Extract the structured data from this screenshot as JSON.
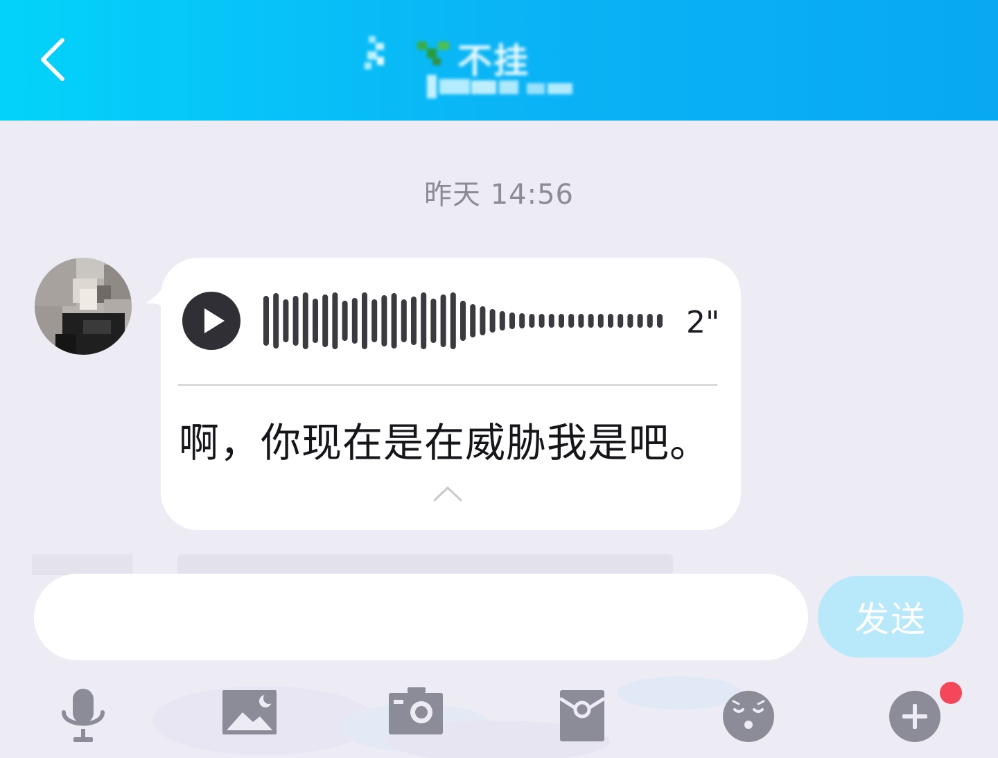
{
  "header": {
    "title": "不挂",
    "back_icon": "chevron-left-icon"
  },
  "chat": {
    "timestamp": "昨天 14:56",
    "messages": [
      {
        "type": "voice",
        "duration": "2\"",
        "transcript": "啊，你现在是在威胁我是吧。",
        "play_icon": "play-icon",
        "collapse_icon": "chevron-up-icon"
      }
    ]
  },
  "composer": {
    "input_value": "",
    "send_label": "发送"
  },
  "toolbar": {
    "items": [
      {
        "icon": "microphone-icon"
      },
      {
        "icon": "image-icon"
      },
      {
        "icon": "camera-icon"
      },
      {
        "icon": "red-packet-icon"
      },
      {
        "icon": "emoji-icon"
      },
      {
        "icon": "plus-icon"
      }
    ],
    "badge_color": "#f5475a"
  },
  "colors": {
    "header_start": "#03d3fb",
    "header_end": "#08a8f3",
    "background": "#edecf5",
    "icon_gray": "#8c8b98",
    "send_disabled": "#b7e9fb"
  }
}
